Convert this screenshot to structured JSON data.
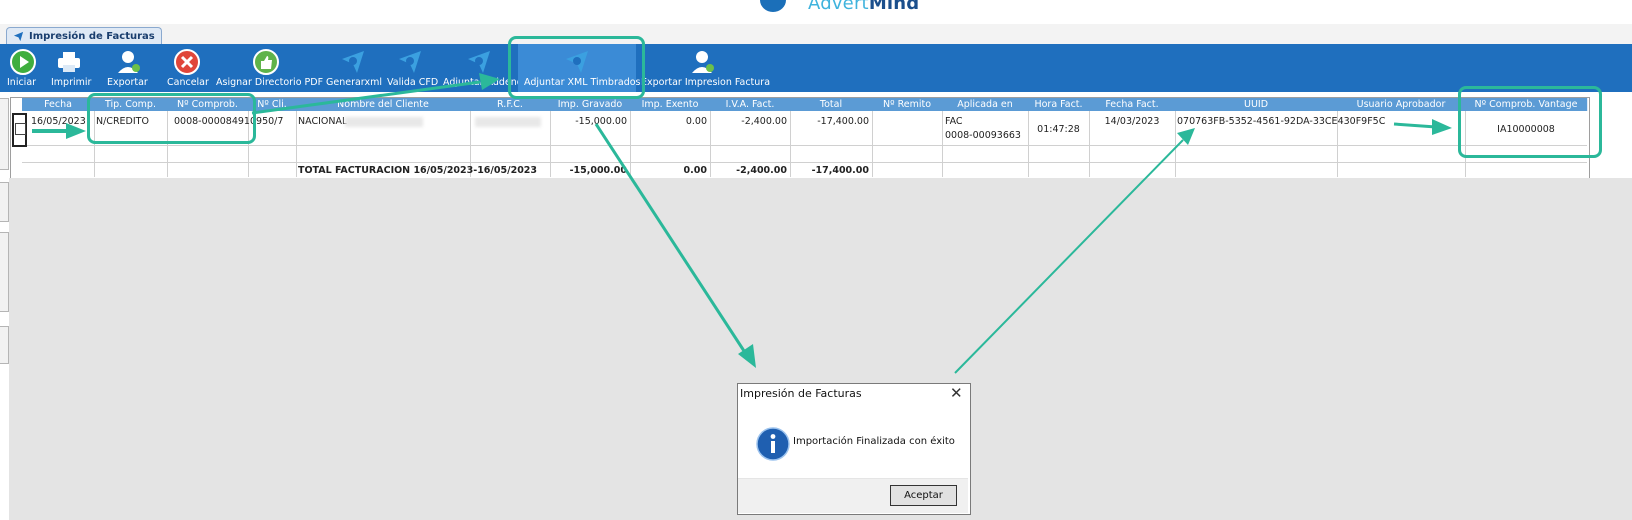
{
  "logo": {
    "text_light": "Advert",
    "text_bold": "Mind"
  },
  "tab": {
    "label": "Impresión de Facturas"
  },
  "toolbar": {
    "items": [
      {
        "label": "Iniciar",
        "icon": "play-icon"
      },
      {
        "label": "Imprimir",
        "icon": "printer-icon"
      },
      {
        "label": "Exportar",
        "icon": "user-export-icon"
      },
      {
        "label": "Cancelar",
        "icon": "cancel-icon"
      },
      {
        "label": "Asignar Directorio PDF",
        "icon": "thumbs-up-icon"
      },
      {
        "label": "Generarxml",
        "icon": "brand-icon"
      },
      {
        "label": "Valida CFD",
        "icon": "brand-icon"
      },
      {
        "label": "Adjuntar Addenda",
        "icon": "brand-icon"
      },
      {
        "label": "Adjuntar XML Timbrados",
        "icon": "brand-icon"
      },
      {
        "label": "Exportar Impresion Factura",
        "icon": "user-export-icon"
      }
    ]
  },
  "grid": {
    "columns": [
      "Fecha",
      "Tip. Comp.",
      "Nº Comprob.",
      "Nº Cli.",
      "Nombre del Cliente",
      "R.F.C.",
      "Imp. Gravado",
      "Imp. Exento",
      "I.V.A. Fact.",
      "Total",
      "Nº Remito",
      "Aplicada en",
      "Hora Fact.",
      "Fecha Fact.",
      "UUID",
      "Usuario Aprobador",
      "Nº Comprob. Vantage"
    ],
    "row": {
      "fecha": "16/05/2023",
      "tip_comp": "N/CREDITO",
      "comprob": "0008-00008491",
      "cli": "0950/7",
      "cliente": "NACIONAL",
      "imp_gravado": "-15,000.00",
      "imp_exento": "0.00",
      "iva": "-2,400.00",
      "total": "-17,400.00",
      "aplicada_1": "FAC",
      "aplicada_2": "0008-00093663",
      "hora": "01:47:28",
      "fecha_fact": "14/03/2023",
      "uuid": "070763FB-5352-4561-92DA-33CE430F9F5C",
      "vantage": "IA10000008"
    },
    "total_row": {
      "label": "TOTAL FACTURACION 16/05/2023-16/05/2023",
      "imp_gravado": "-15,000.00",
      "imp_exento": "0.00",
      "iva": "-2,400.00",
      "total": "-17,400.00"
    }
  },
  "dialog": {
    "title": "Impresión de Facturas",
    "message": "Importación Finalizada con éxito",
    "ok": "Aceptar",
    "close": "✕"
  },
  "colors": {
    "toolbar": "#1f6fbe",
    "header": "#5b9bd5",
    "highlight": "#2bb89a"
  }
}
